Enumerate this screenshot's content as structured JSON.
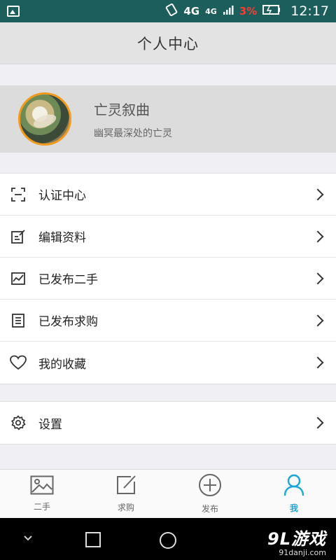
{
  "status_bar": {
    "network_1": "4G",
    "network_2": "4G",
    "battery_percent": "3%",
    "time": "12:17"
  },
  "header": {
    "title": "个人中心"
  },
  "profile": {
    "name": "亡灵叙曲",
    "signature": "幽冥最深处的亡灵"
  },
  "menu_group_1": [
    {
      "label": "认证中心",
      "icon": "scan-frame-icon"
    },
    {
      "label": "编辑资料",
      "icon": "edit-note-icon"
    },
    {
      "label": "已发布二手",
      "icon": "chart-image-icon"
    },
    {
      "label": "已发布求购",
      "icon": "list-board-icon"
    },
    {
      "label": "我的收藏",
      "icon": "heart-icon"
    }
  ],
  "menu_group_2": [
    {
      "label": "设置",
      "icon": "gear-icon"
    }
  ],
  "tabs": [
    {
      "label": "二手",
      "icon": "image-icon",
      "active": false
    },
    {
      "label": "求购",
      "icon": "pencil-square-icon",
      "active": false
    },
    {
      "label": "发布",
      "icon": "plus-circle-icon",
      "active": false
    },
    {
      "label": "我",
      "icon": "user-icon",
      "active": true
    }
  ],
  "colors": {
    "accent": "#19a7d9",
    "avatar_ring": "#f29a1d",
    "status_bar": "#1b5e5b",
    "battery_low": "#ff3b30"
  },
  "watermark": {
    "main": "9L游戏",
    "sub": "91danji.com"
  }
}
